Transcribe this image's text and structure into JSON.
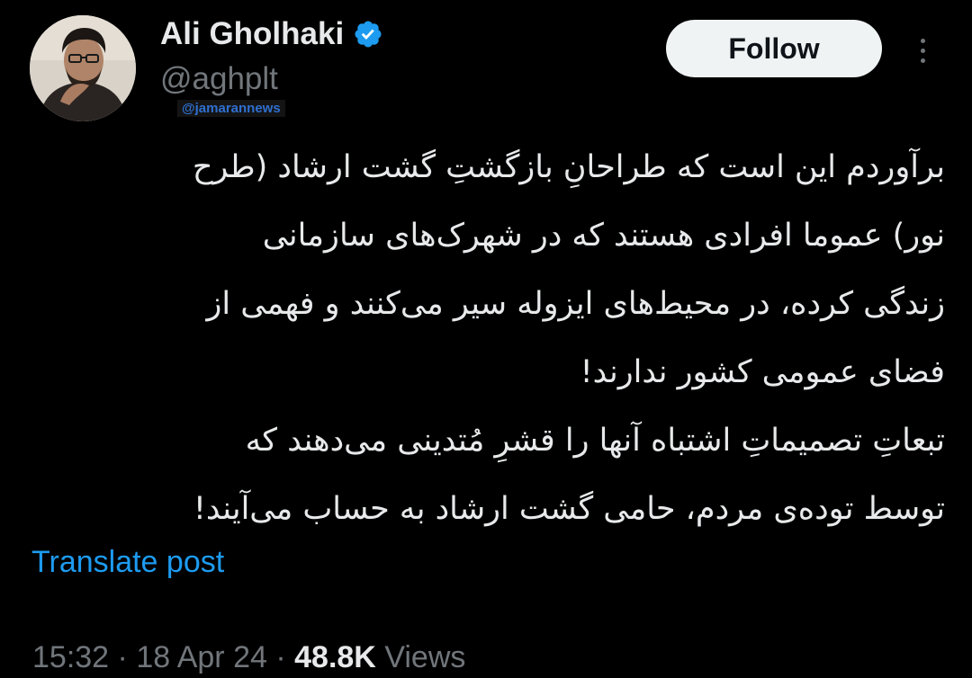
{
  "author": {
    "display_name": "Ali Gholhaki",
    "handle": "@aghplt",
    "verified": true,
    "verified_color": "#1d9bf0"
  },
  "watermark": "@jamarannews",
  "actions": {
    "follow_label": "Follow",
    "more_icon": "more-horizontal-icon"
  },
  "tweet": {
    "lines": [
      "برآوردم این است که طراحانِ بازگشتِ گشت ارشاد (طرح",
      "نور) عموما افرادی هستند که در شهرک‌های سازمانی",
      "زندگی کرده، در محیط‌های ایزوله سیر می‌کنند و فهمی از",
      "فضای عمومی کشور ندارند!",
      "تبعاتِ تصمیماتِ اشتباه آنها را قشرِ مُتدینی می‌دهند که",
      "توسط توده‌ی مردم، حامی گشت ارشاد به حساب می‌آیند!"
    ],
    "translate_label": "Translate post"
  },
  "meta": {
    "time": "15:32",
    "separator": "·",
    "date": "18 Apr 24",
    "views_count": "48.8K",
    "views_label": "Views"
  },
  "colors": {
    "background": "#000000",
    "text_primary": "#e7e9ea",
    "text_secondary": "#71767b",
    "link": "#1d9bf0"
  }
}
